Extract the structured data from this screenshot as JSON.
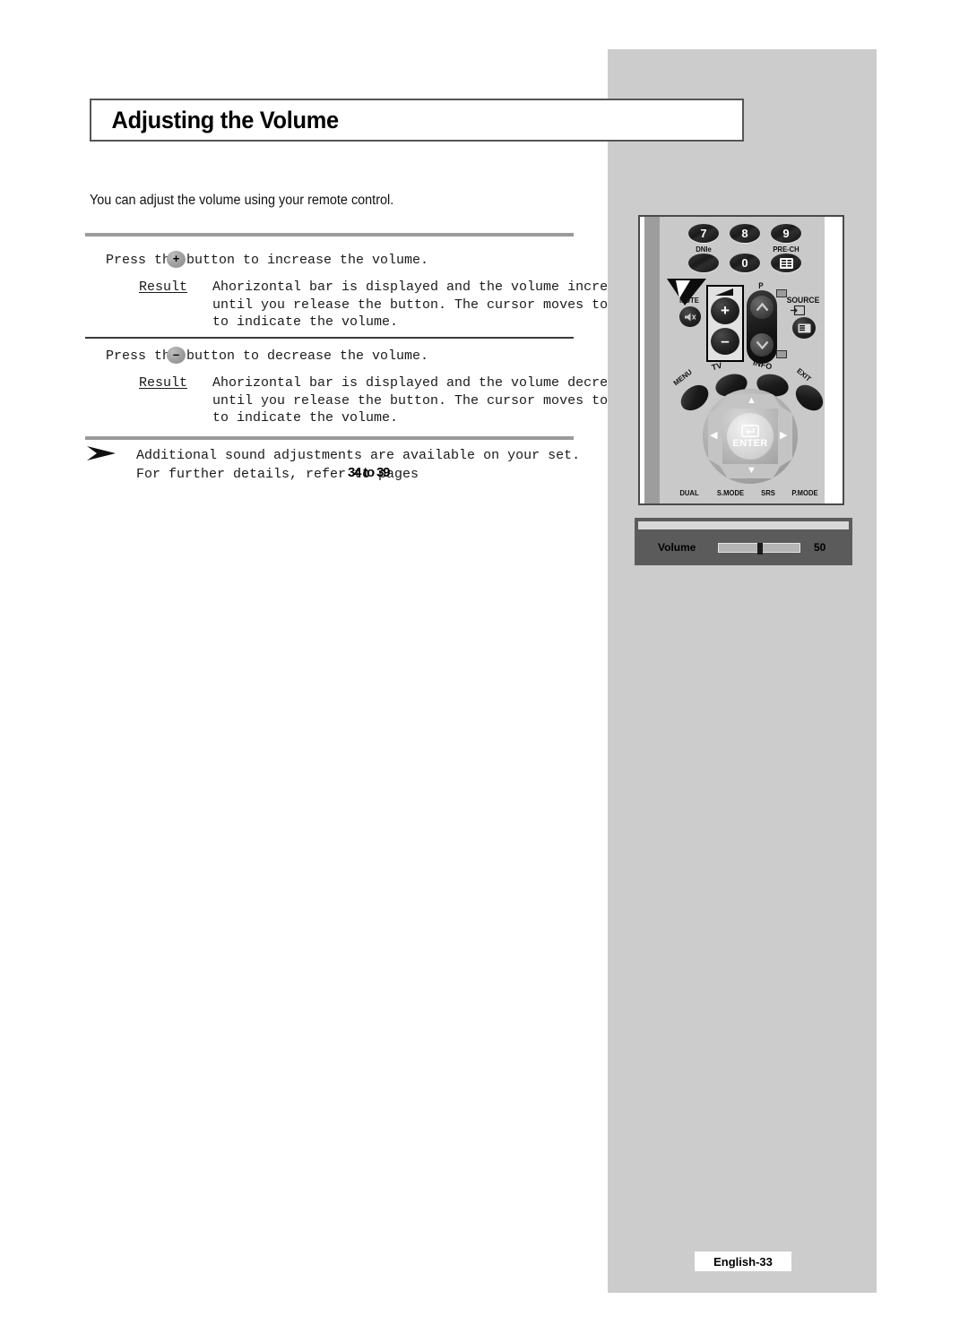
{
  "page": {
    "title": "Adjusting the Volume",
    "intro": "You can adjust the volume using your remote control.",
    "footer_badge": "English-33"
  },
  "steps": [
    {
      "lead_before": "Press th",
      "key_glyph": "+",
      "lead_after": "  button to increase the volume.",
      "result_label": "Result",
      "result_lines": [
        "Ahorizontal bar is displayed and the volume increases",
        "until you release the button. The cursor moves to the right",
        "to indicate the volume."
      ]
    },
    {
      "lead_before": "Press th",
      "key_glyph": "–",
      "lead_after": "  button to decrease the volume.",
      "result_label": "Result",
      "result_lines": [
        "Ahorizontal bar is displayed and the volume decreases",
        "until you release the button. The cursor moves to the left",
        "to indicate the volume."
      ]
    }
  ],
  "note": {
    "bullet_icon": "arrow-bullet-icon",
    "lines": [
      "Additional sound adjustments are available on your set.",
      "For further details, refer to pages"
    ],
    "pages_overlay": "34 to 39"
  },
  "remote": {
    "number_buttons": [
      "7",
      "8",
      "9"
    ],
    "zero_button": "0",
    "dnie_label": "DNIe",
    "prech_label": "PRE-CH",
    "mute_label": "MUTE",
    "source_label": "SOURCE",
    "program_label": "P",
    "volume_plus": "+",
    "volume_minus": "–",
    "tv_label": "TV",
    "info_label": "INFO",
    "menu_label": "MENU",
    "exit_label": "EXIT",
    "enter_label": "ENTER",
    "dpad_up": "▲",
    "dpad_down": "▼",
    "dpad_left": "◀",
    "dpad_right": "▶",
    "bottom_labels": [
      "DUAL",
      "S.MODE",
      "SRS",
      "P.MODE"
    ],
    "pointer_icon": "pointer-arrow-icon",
    "volume_highlight_icon": "volume-up-wedge-icon"
  },
  "osd": {
    "label": "Volume",
    "value": "50",
    "level_percent": 50
  }
}
